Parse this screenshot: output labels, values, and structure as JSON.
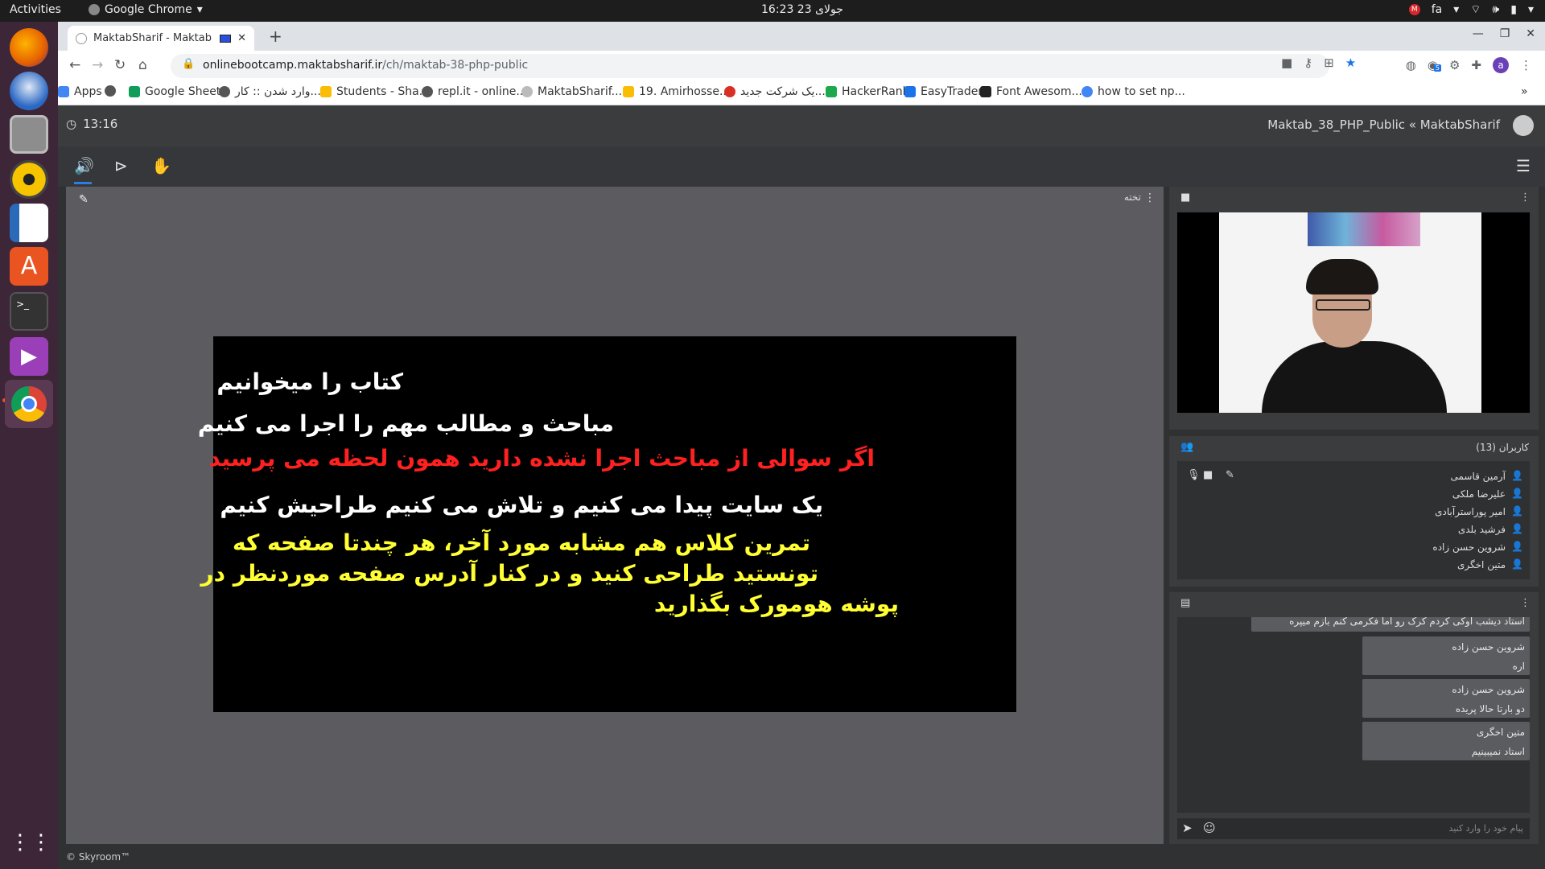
{
  "topbar": {
    "activities": "Activities",
    "app_name": "Google Chrome",
    "clock": "16:23  23 جولای",
    "lang": "fa",
    "mail_badge": "M"
  },
  "chrome": {
    "tab_title": "MaktabSharif - Maktab",
    "url_host": "onlinebootcamp.maktabsharif.ir",
    "url_path": "/ch/maktab-38-php-public",
    "profile_letter": "a",
    "ext_badge": "5",
    "bookmarks": [
      {
        "label": "Apps",
        "color": "#4285f4"
      },
      {
        "label": "",
        "color": "#555555"
      },
      {
        "label": "Google Sheets",
        "color": "#0f9d58"
      },
      {
        "label": "وارد شدن :: کار...",
        "color": "#555555"
      },
      {
        "label": "Students - Sha...",
        "color": "#fbbc04"
      },
      {
        "label": "repl.it - online...",
        "color": "#555555"
      },
      {
        "label": "MaktabSharif...",
        "color": "#bbbbbb"
      },
      {
        "label": "19. Amirhosse...",
        "color": "#fbbc04"
      },
      {
        "label": "یک شرکت جدید...",
        "color": "#d93025"
      },
      {
        "label": "HackerRank",
        "color": "#1ba94c"
      },
      {
        "label": "EasyTrader",
        "color": "#1a73e8"
      },
      {
        "label": "Font Awesom...",
        "color": "#222222"
      },
      {
        "label": "how to set np...",
        "color": "#4285f4"
      }
    ]
  },
  "app": {
    "timer": "13:16",
    "room_title": "Maktab_38_PHP_Public « MaktabSharif",
    "board_label": "تخته",
    "users_title": "کاربران (13)",
    "footer": "© Skyroom™",
    "chat_placeholder": "پیام خود را وارد کنید"
  },
  "slide": {
    "lines": [
      {
        "text": "کتاب را میخوانیم",
        "color": "#ffffff"
      },
      {
        "text": "مباحث و مطالب مهم را اجرا می کنیم",
        "color": "#ffffff"
      },
      {
        "text": "اگر سوالی از مباحث اجرا نشده دارید همون لحظه می پرسید",
        "color": "#ff2020"
      },
      {
        "text": "یک سایت پیدا می کنیم و تلاش می کنیم طراحیش کنیم",
        "color": "#ffffff"
      },
      {
        "text": "تمرین کلاس هم مشابه مورد آخر، هر چندتا صفحه که",
        "color": "#ffff33"
      },
      {
        "text": "تونستید طراحی کنید و در کنار آدرس صفحه موردنظر در",
        "color": "#ffff33"
      },
      {
        "text": "پوشه هومورک بگذارید",
        "color": "#ffff33"
      }
    ]
  },
  "users": [
    {
      "name": "آرمین قاسمی",
      "color": "#3b7ddd"
    },
    {
      "name": "علیرضا ملکی",
      "color": "#3b7ddd"
    },
    {
      "name": "امیر پوراستر‌آبادی",
      "color": "#dddddd"
    },
    {
      "name": "فرشید بلدی",
      "color": "#dddddd"
    },
    {
      "name": "شروین حسن زاده",
      "color": "#dddddd"
    },
    {
      "name": "متین اخگری",
      "color": "#dddddd"
    }
  ],
  "chat": [
    {
      "who": "",
      "text": "استاد دیشب اوکی کردم کرک رو اما فکرمی کنم بازم میپره"
    },
    {
      "who": "شروین حسن زاده",
      "text": "اره"
    },
    {
      "who": "شروین حسن زاده",
      "text": "دو بارتا حالا پریده"
    },
    {
      "who": "متین اخگری",
      "text": "استاد نمیبینیم"
    }
  ]
}
